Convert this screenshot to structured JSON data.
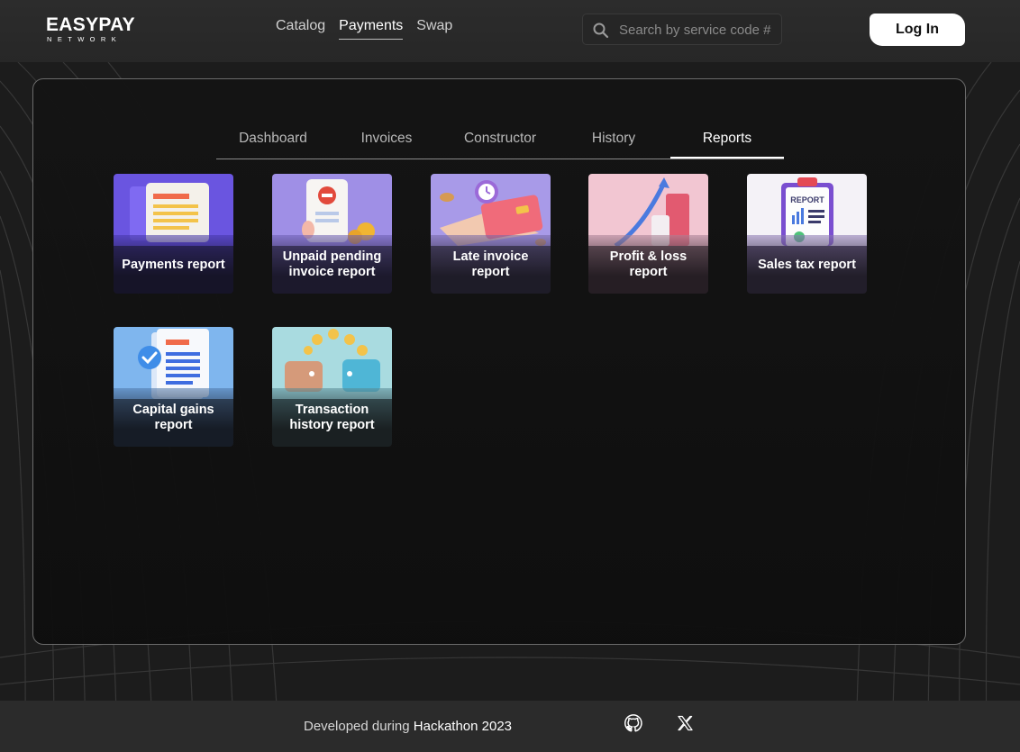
{
  "header": {
    "logo_main": "EASYPAY",
    "logo_sub": "NETWORK",
    "nav": [
      {
        "label": "Catalog",
        "active": false
      },
      {
        "label": "Payments",
        "active": true
      },
      {
        "label": "Swap",
        "active": false
      }
    ],
    "search_placeholder": "Search by service code #",
    "login_label": "Log In"
  },
  "tabs": [
    {
      "label": "Dashboard",
      "active": false
    },
    {
      "label": "Invoices",
      "active": false
    },
    {
      "label": "Constructor",
      "active": false
    },
    {
      "label": "History",
      "active": false
    },
    {
      "label": "Reports",
      "active": true
    }
  ],
  "reports": [
    {
      "line1": "Payments report",
      "line2": "",
      "icon": "document-icon"
    },
    {
      "line1": "Unpaid pending",
      "line2": "invoice report",
      "icon": "unpaid-receipt-icon"
    },
    {
      "line1": "Late invoice",
      "line2": "report",
      "icon": "clock-card-icon"
    },
    {
      "line1": "Profit & loss",
      "line2": "report",
      "icon": "growth-chart-icon"
    },
    {
      "line1": "Sales tax report",
      "line2": "",
      "icon": "clipboard-report-icon",
      "image_text": "REPORT"
    },
    {
      "line1": "Capital gains",
      "line2": "report",
      "icon": "checked-document-icon"
    },
    {
      "line1": "Transaction",
      "line2": "history report",
      "icon": "wallets-coins-icon"
    }
  ],
  "footer": {
    "prefix": "Developed during",
    "event": "Hackathon 2023"
  },
  "colors": {
    "background": "#1c1c1c",
    "panel_border": "#6b6b6b",
    "accent": "#ffffff"
  }
}
